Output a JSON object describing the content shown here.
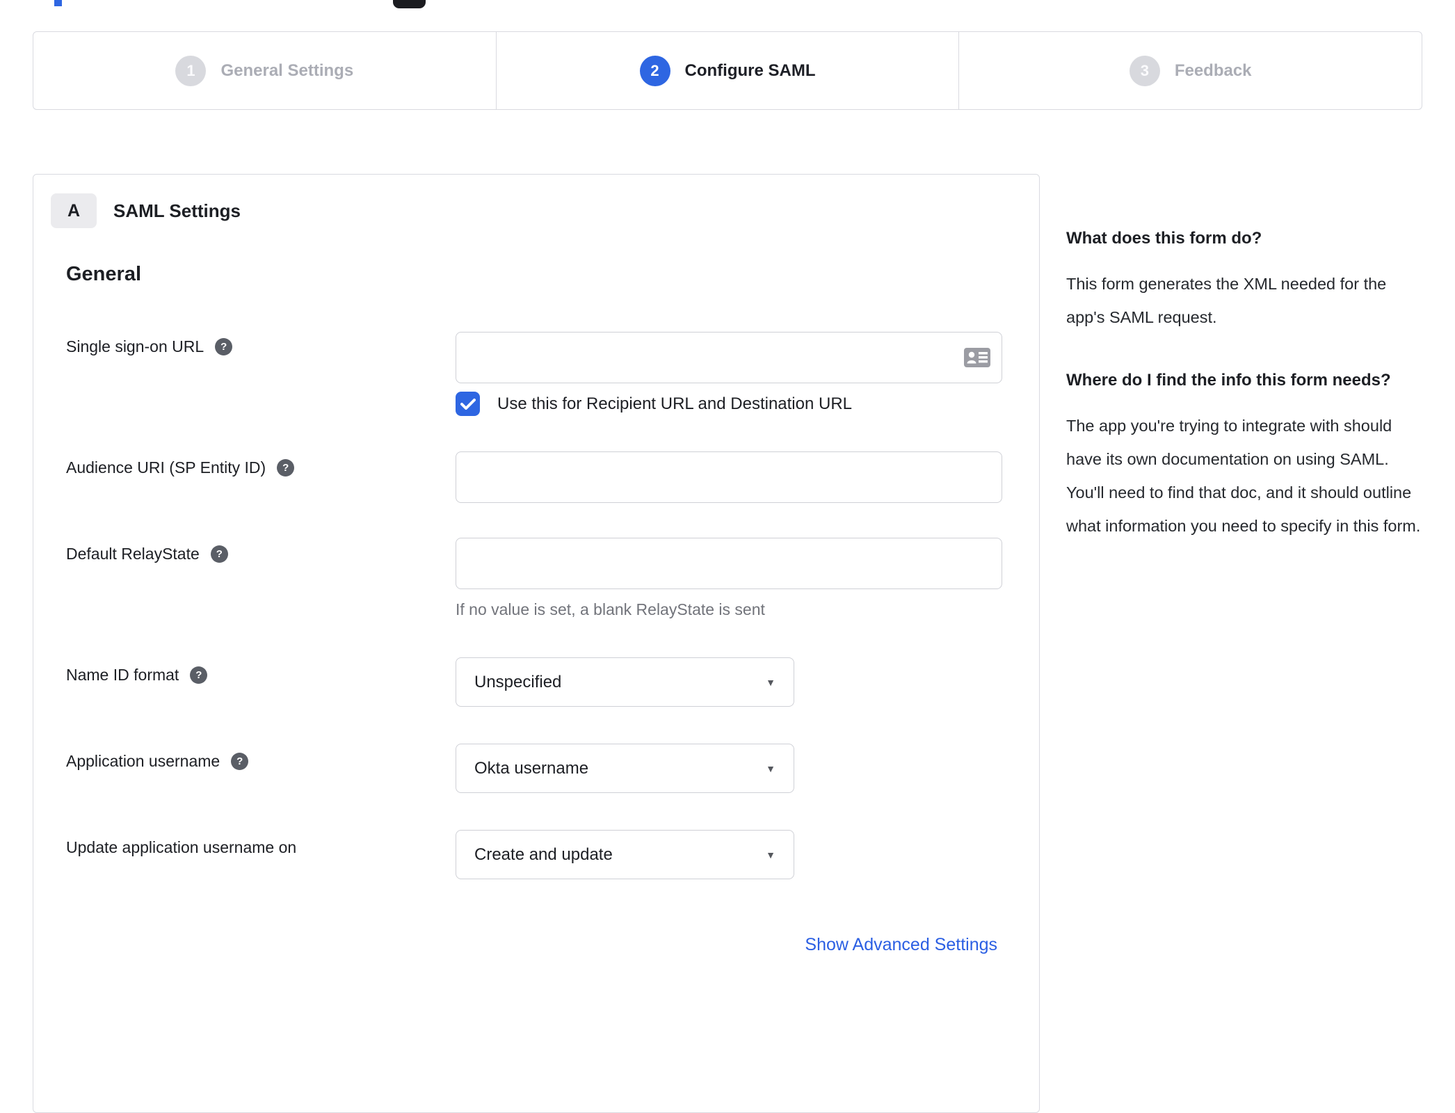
{
  "colors": {
    "accent_blue": "#2e66e2",
    "link_blue": "#2b5fe3",
    "border_gray": "#d9dae0",
    "inactive_gray": "#d8d9de",
    "help_icon_gray": "#5a5e66",
    "hint_gray": "#72747b"
  },
  "icons": {
    "help_glyph": "?",
    "dropdown_arrow": "▼"
  },
  "stepper": {
    "steps": [
      {
        "number": "1",
        "label": "General Settings",
        "state": "inactive"
      },
      {
        "number": "2",
        "label": "Configure SAML",
        "state": "active"
      },
      {
        "number": "3",
        "label": "Feedback",
        "state": "inactive"
      }
    ]
  },
  "form_card": {
    "section_badge": "A",
    "section_title": "SAML Settings",
    "group_heading": "General",
    "sso_url": {
      "label": "Single sign-on URL",
      "value": ""
    },
    "sso_checkbox": {
      "label": "Use this for Recipient URL and Destination URL",
      "checked": true
    },
    "audience_uri": {
      "label": "Audience URI (SP Entity ID)",
      "value": ""
    },
    "relay_state": {
      "label": "Default RelayState",
      "value": "",
      "hint": "If no value is set, a blank RelayState is sent"
    },
    "name_id_format": {
      "label": "Name ID format",
      "value": "Unspecified"
    },
    "app_username": {
      "label": "Application username",
      "value": "Okta username"
    },
    "update_username": {
      "label": "Update application username on",
      "value": "Create and update"
    },
    "advanced_link": "Show Advanced Settings"
  },
  "sidebar": {
    "sections": [
      {
        "heading": "What does this form do?",
        "body": "This form generates the XML needed for the app's SAML request."
      },
      {
        "heading": "Where do I find the info this form needs?",
        "body": "The app you're trying to integrate with should have its own documentation on using SAML. You'll need to find that doc, and it should outline what information you need to specify in this form."
      }
    ]
  }
}
